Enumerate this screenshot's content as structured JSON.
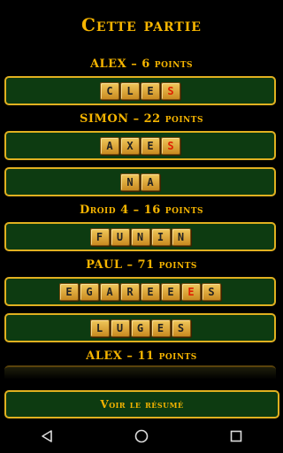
{
  "title": "Cette partie",
  "players": [
    {
      "label": "ALEX – 6 points",
      "words": [
        [
          {
            "l": "C"
          },
          {
            "l": "L"
          },
          {
            "l": "E"
          },
          {
            "l": "S",
            "red": true
          }
        ]
      ]
    },
    {
      "label": "SIMON – 22 points",
      "words": [
        [
          {
            "l": "A"
          },
          {
            "l": "X"
          },
          {
            "l": "E"
          },
          {
            "l": "S",
            "red": true
          }
        ],
        [
          {
            "l": "N"
          },
          {
            "l": "A"
          }
        ]
      ]
    },
    {
      "label": "Droid 4 – 16 points",
      "words": [
        [
          {
            "l": "F"
          },
          {
            "l": "U"
          },
          {
            "l": "N"
          },
          {
            "l": "I"
          },
          {
            "l": "N"
          }
        ]
      ]
    },
    {
      "label": "PAUL – 71 points",
      "words": [
        [
          {
            "l": "E"
          },
          {
            "l": "G"
          },
          {
            "l": "A"
          },
          {
            "l": "R"
          },
          {
            "l": "E"
          },
          {
            "l": "E"
          },
          {
            "l": "E",
            "red": true
          },
          {
            "l": "S"
          }
        ],
        [
          {
            "l": "L"
          },
          {
            "l": "U"
          },
          {
            "l": "G"
          },
          {
            "l": "E"
          },
          {
            "l": "S"
          }
        ]
      ]
    },
    {
      "label": "ALEX – 11 points",
      "words": []
    }
  ],
  "summary_button": "Voir le résumé",
  "nav": {
    "back": "back-icon",
    "home": "home-icon",
    "recents": "recents-icon"
  },
  "colors": {
    "accent": "#f5b400",
    "panel": "#0d3b11",
    "border": "#e0b020",
    "tile": "#e8b64a",
    "red_letter": "#e02000"
  }
}
